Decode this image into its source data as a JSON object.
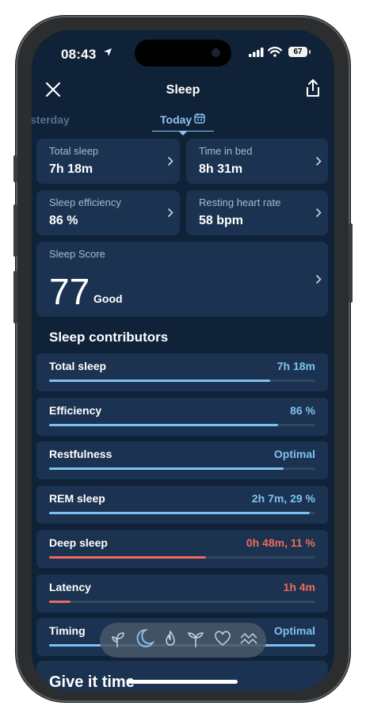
{
  "status_bar": {
    "time": "08:43",
    "battery": "67"
  },
  "header": {
    "title": "Sleep"
  },
  "date_tabs": {
    "previous": "sterday",
    "current": "Today"
  },
  "metrics": [
    {
      "label": "Total sleep",
      "value": "7h 18m"
    },
    {
      "label": "Time in bed",
      "value": "8h 31m"
    },
    {
      "label": "Sleep efficiency",
      "value": "86 %"
    },
    {
      "label": "Resting heart rate",
      "value": "58 bpm"
    }
  ],
  "score": {
    "label": "Sleep Score",
    "value": "77",
    "rating": "Good"
  },
  "contributors_title": "Sleep contributors",
  "contributors": [
    {
      "label": "Total sleep",
      "value": "7h 18m",
      "fill": 0.83,
      "status": "good"
    },
    {
      "label": "Efficiency",
      "value": "86 %",
      "fill": 0.86,
      "status": "good"
    },
    {
      "label": "Restfulness",
      "value": "Optimal",
      "fill": 0.88,
      "status": "good"
    },
    {
      "label": "REM sleep",
      "value": "2h 7m, 29 %",
      "fill": 0.98,
      "status": "good"
    },
    {
      "label": "Deep sleep",
      "value": "0h 48m, 11 %",
      "fill": 0.59,
      "status": "low"
    },
    {
      "label": "Latency",
      "value": "1h 4m",
      "fill": 0.08,
      "status": "low"
    },
    {
      "label": "Timing",
      "value": "Optimal",
      "fill": 1.0,
      "status": "good"
    }
  ],
  "colors": {
    "good": "#7ec1f0",
    "low": "#ee6a5c",
    "accent": "#8fc4f2",
    "background": "#0f2238",
    "card": "#1b3350"
  },
  "bottom_nav": [
    "sprout-icon",
    "moon-icon",
    "flame-icon",
    "leaf-pair-icon",
    "heart-icon",
    "waves-icon"
  ],
  "footer_card": {
    "title": "Give it time"
  }
}
